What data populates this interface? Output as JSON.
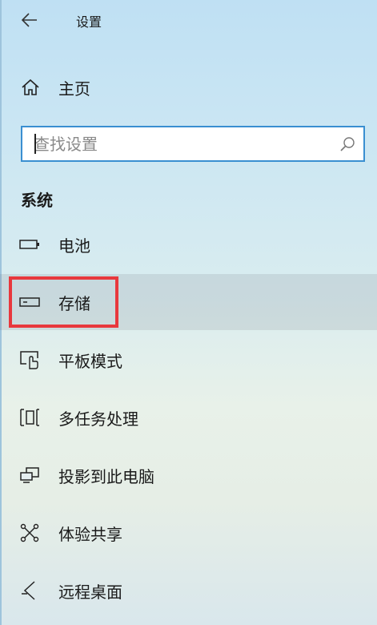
{
  "header": {
    "title": "设置",
    "back_icon": "back-arrow-icon"
  },
  "home": {
    "label": "主页",
    "icon": "home-icon"
  },
  "search": {
    "placeholder": "查找设置",
    "value": "",
    "icon": "search-icon"
  },
  "section": {
    "title": "系统"
  },
  "nav": {
    "items": [
      {
        "label": "电池",
        "icon": "battery-icon"
      },
      {
        "label": "存储",
        "icon": "storage-drive-icon",
        "selected": true
      },
      {
        "label": "平板模式",
        "icon": "tablet-mode-icon"
      },
      {
        "label": "多任务处理",
        "icon": "multitasking-icon"
      },
      {
        "label": "投影到此电脑",
        "icon": "project-to-pc-icon"
      },
      {
        "label": "体验共享",
        "icon": "shared-experiences-icon"
      },
      {
        "label": "远程桌面",
        "icon": "remote-desktop-icon"
      }
    ]
  },
  "colors": {
    "accent": "#3a8fd1",
    "highlight_annotation": "#e8383d"
  }
}
